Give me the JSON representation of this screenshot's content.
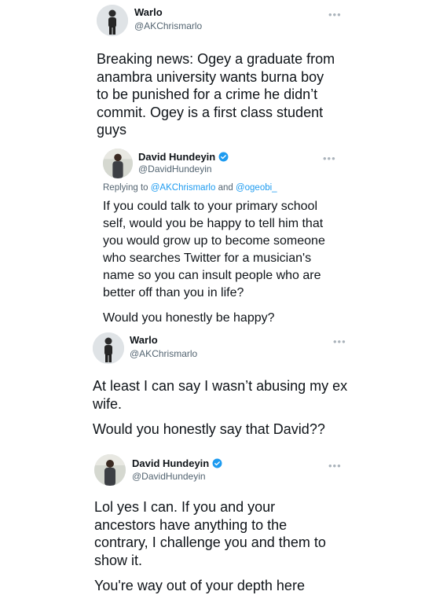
{
  "tweets": [
    {
      "name": "Warlo",
      "handle": "@AKChrismarlo",
      "verified": false,
      "paragraphs": [
        "Breaking news: Ogey a graduate from anambra university wants burna boy to be punished for a crime he didn’t commit. Ogey is a first class student guys"
      ]
    },
    {
      "name": "David Hundeyin",
      "handle": "@DavidHundeyin",
      "verified": true,
      "replying_prefix": "Replying to",
      "replying_user1": "@AKChrismarlo",
      "replying_and": "and",
      "replying_user2": "@ogeobi_",
      "paragraphs": [
        "If you could talk to your primary school self, would you be happy to tell him that you would grow up to become someone who searches Twitter for a musician's name so you can insult people who are better off than you in life?",
        "Would you honestly be happy?"
      ]
    },
    {
      "name": "Warlo",
      "handle": "@AKChrismarlo",
      "verified": false,
      "paragraphs": [
        "At least I can say I wasn’t abusing my ex wife.",
        "Would you honestly say that David??"
      ]
    },
    {
      "name": "David Hundeyin",
      "handle": "@DavidHundeyin",
      "verified": true,
      "paragraphs": [
        "Lol yes I can. If you and your ancestors have anything to the contrary, I challenge you and them to show it.",
        "You're way out of your depth here"
      ]
    }
  ],
  "more_icon": "more-horizontal-icon",
  "verified_icon": "verified-badge-icon",
  "colors": {
    "link": "#1d9bf0",
    "secondary": "#536471",
    "text": "#0f1419"
  }
}
